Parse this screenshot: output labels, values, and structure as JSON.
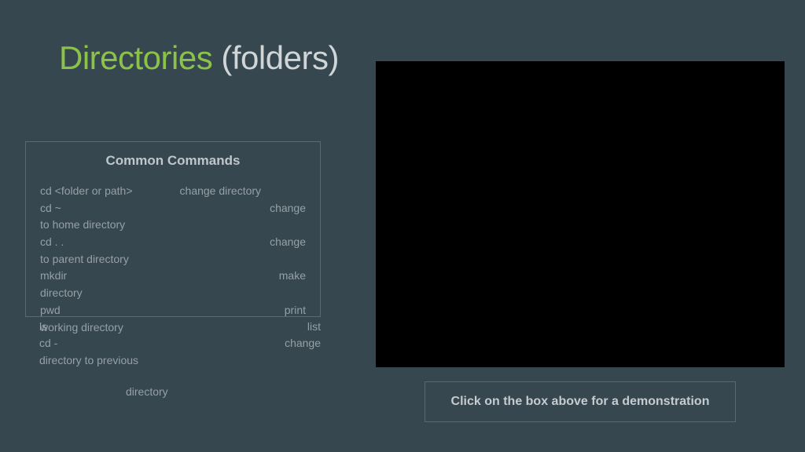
{
  "title": {
    "main": "Directories",
    "sub": "(folders)"
  },
  "commands": {
    "heading": "Common Commands",
    "rows": [
      {
        "left": "cd <folder or path>",
        "right": "change directory",
        "rightFar": false
      },
      {
        "left": "cd ~",
        "right": "change",
        "rightFar": true
      },
      {
        "left": "to home directory",
        "right": "",
        "rightFar": false
      },
      {
        "left": "cd . .",
        "right": "change",
        "rightFar": true
      },
      {
        "left": "to parent directory",
        "right": "",
        "rightFar": false
      },
      {
        "left": "mkdir",
        "right": "make",
        "rightFar": true
      },
      {
        "left": "directory",
        "right": "",
        "rightFar": false
      },
      {
        "left": "pwd",
        "right": "print",
        "rightFar": true
      },
      {
        "left": "working directory",
        "right": "",
        "rightFar": false
      }
    ]
  },
  "overflow": {
    "line1l": "ls",
    "line1r": "list",
    "line2l": "cd -",
    "line2r": "change",
    "line3": "directory to previous",
    "line4": "directory"
  },
  "instruction": "Click on the box above for a demonstration"
}
